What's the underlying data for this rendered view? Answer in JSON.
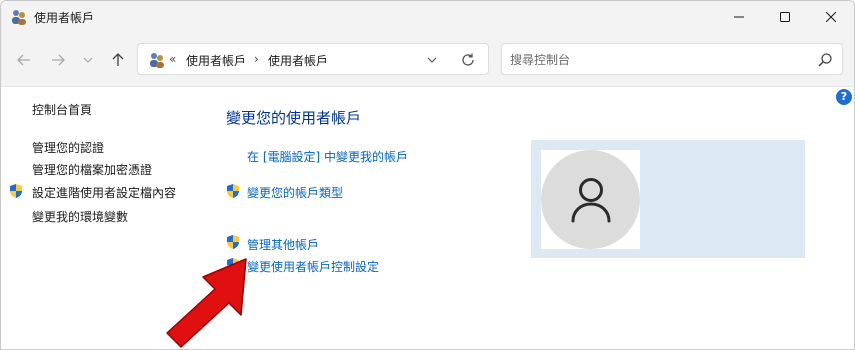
{
  "window": {
    "title": "使用者帳戶",
    "controls": {
      "minimize": "minimize",
      "maximize": "maximize",
      "close": "close"
    }
  },
  "navbar": {
    "breadcrumb_sep": "«",
    "path": [
      "使用者帳戶",
      "使用者帳戶"
    ],
    "path_arrow": "›",
    "search": {
      "placeholder": "搜尋控制台",
      "value": ""
    }
  },
  "sidebar": {
    "home": "控制台首頁",
    "items": [
      {
        "label": "管理您的認證",
        "shield": false
      },
      {
        "label": "管理您的檔案加密憑證",
        "shield": false
      },
      {
        "label": "設定進階使用者設定檔內容",
        "shield": true
      },
      {
        "label": "變更我的環境變數",
        "shield": false
      }
    ]
  },
  "main": {
    "title": "變更您的使用者帳戶",
    "links": [
      {
        "label": "在 [電腦設定] 中變更我的帳戶",
        "shield": false
      },
      {
        "label": "變更您的帳戶類型",
        "shield": true
      },
      {
        "label": "管理其他帳戶",
        "shield": true
      },
      {
        "label": "變更使用者帳戶控制設定",
        "shield": true
      }
    ]
  },
  "help": {
    "label": "?"
  },
  "colors": {
    "title_blue": "#003399",
    "link_blue": "#0066cc",
    "panel_bg": "#dde8f5",
    "arrow_red": "#e01010",
    "help_blue": "#1e6fd0"
  },
  "icons": {
    "title": "users-icon",
    "shield": "uac-shield-icon",
    "avatar": "user-avatar-icon",
    "pointer": "red-arrow-annotation"
  }
}
